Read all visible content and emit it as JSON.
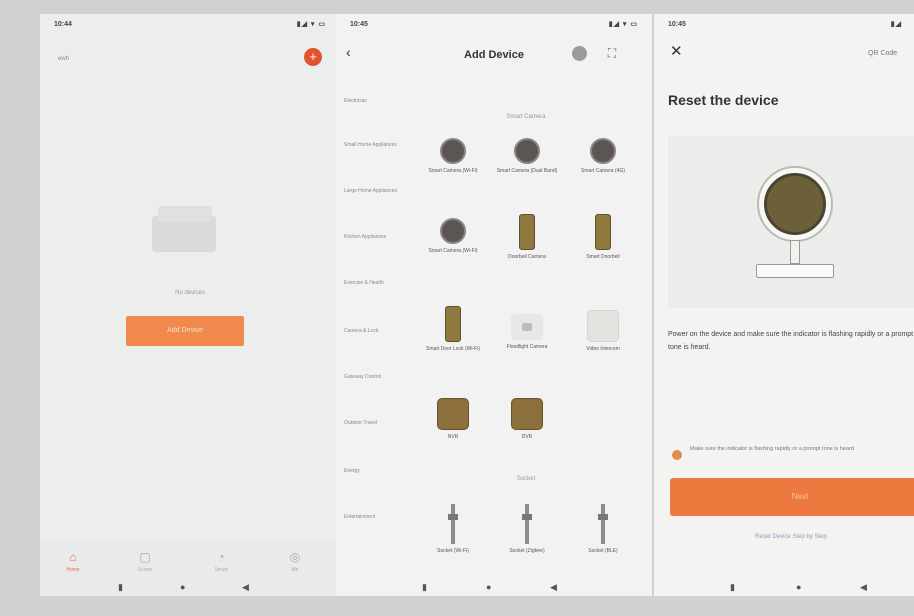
{
  "colors": {
    "accent": "#e8703c",
    "button": "#ec7a3e",
    "background": "#cfd2d0"
  },
  "phone1": {
    "status_time": "10:44",
    "status_icons": "▮◢ ▾ ▭",
    "home_name": "ewh",
    "add_icon": "plus-circle-icon",
    "empty_text": "No devices",
    "add_device_label": "Add Device",
    "tabs": [
      {
        "label": "Home",
        "icon": "home-icon",
        "active": true
      },
      {
        "label": "Scene",
        "icon": "scene-icon",
        "active": false
      },
      {
        "label": "Smart",
        "icon": "smart-icon",
        "active": false
      },
      {
        "label": "Me",
        "icon": "me-icon",
        "active": false
      }
    ]
  },
  "phone2": {
    "status_time": "10:45",
    "status_icons": "▮◢ ▾ ▭",
    "title": "Add Device",
    "categories": [
      "Electrician",
      "Small Home Appliances",
      "Large Home Appliances",
      "Kitchen Appliances",
      "Exercise & Health",
      "Camera & Lock",
      "Gateway Control",
      "Outdoor Travel",
      "Energy",
      "Entertainment"
    ],
    "selected_category_index": 5,
    "section_label": "Smart Camera",
    "devices": [
      {
        "label": "Smart Camera (Wi-Fi)",
        "type": "round"
      },
      {
        "label": "Smart Camera (Dual Band)",
        "type": "round"
      },
      {
        "label": "Smart Camera (4G)",
        "type": "round"
      },
      {
        "label": "Smart Camera (Wi-Fi)",
        "type": "round"
      },
      {
        "label": "Doorbell Camera",
        "type": "tall"
      },
      {
        "label": "Smart Doorbell",
        "type": "tall"
      },
      {
        "label": "Smart Door Lock (Wi-Fi)",
        "type": "tall"
      },
      {
        "label": "Floodlight Camera",
        "type": "cctv"
      },
      {
        "label": "Video Intercom",
        "type": "pale"
      },
      {
        "label": "NVR",
        "type": "square"
      },
      {
        "label": "DVR",
        "type": "square"
      }
    ],
    "section_label_2": "Socket",
    "bottom_devices": [
      {
        "label": "Socket (Wi-Fi)"
      },
      {
        "label": "Socket (Zigbee)"
      },
      {
        "label": "Socket (BLE)"
      }
    ]
  },
  "phone3": {
    "status_time": "10:45",
    "status_icons": "▮◢",
    "close_icon": "close-icon",
    "qr_label": "QR Code",
    "heading": "Reset the device",
    "description": "Power on the device and make sure the indicator is flashing rapidly or a prompt tone is heard.",
    "check_text": "Make sure the indicator is flashing rapidly or a prompt tone is heard",
    "next_label": "Next",
    "step_link": "Reset Device Step by Step"
  }
}
